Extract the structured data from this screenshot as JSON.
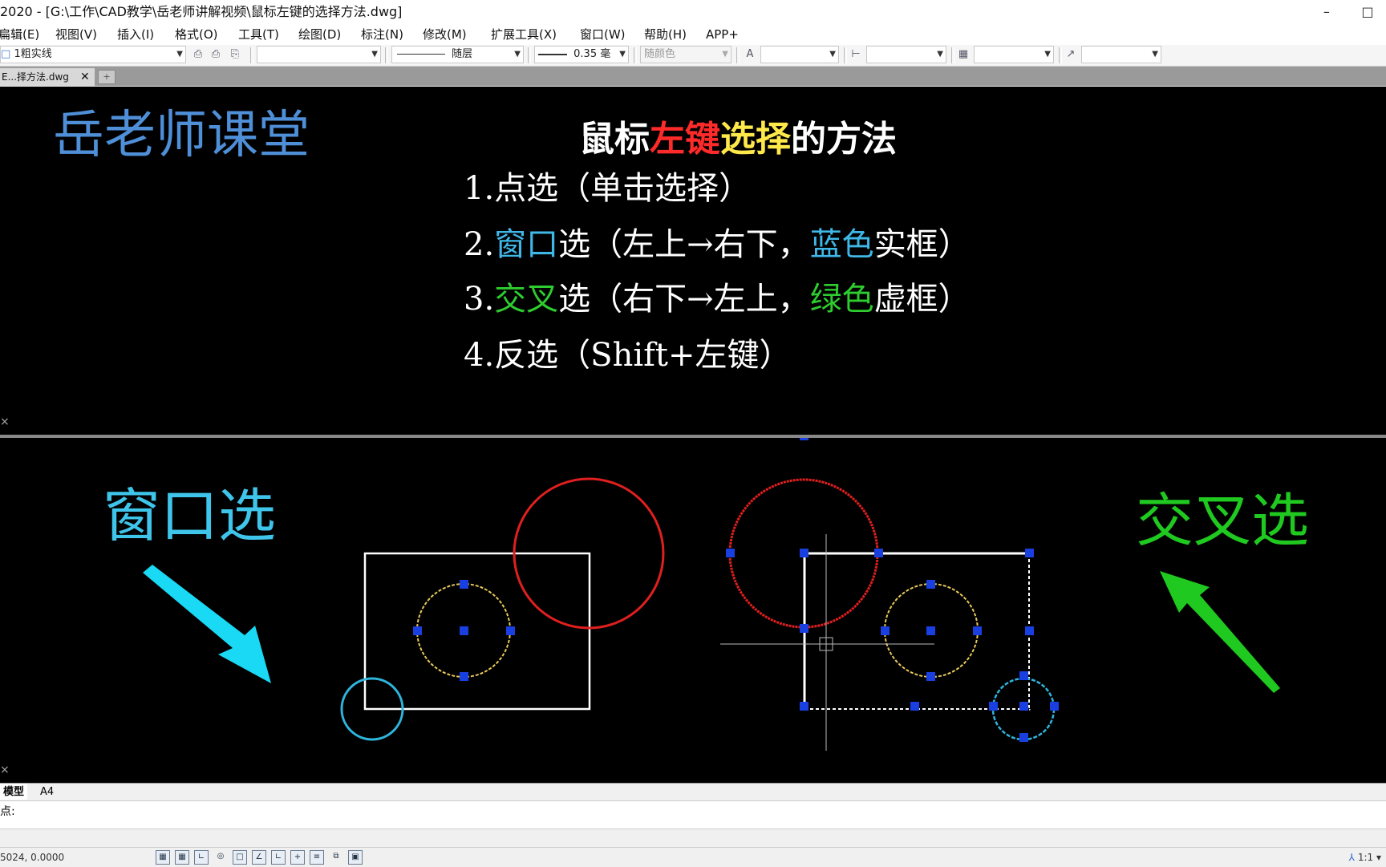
{
  "window": {
    "title": "2020 - [G:\\工作\\CAD教学\\岳老师讲解视频\\鼠标左键的选择方法.dwg]",
    "min_icon": "minimize-icon",
    "max_icon": "maximize-icon",
    "close_icon": "close-icon"
  },
  "menu": [
    "编辑(E)",
    "视图(V)",
    "插入(I)",
    "格式(O)",
    "工具(T)",
    "绘图(D)",
    "标注(N)",
    "修改(M)",
    "扩展工具(X)",
    "窗口(W)",
    "帮助(H)",
    "APP+"
  ],
  "menu_first_display": "扁辑(E)",
  "toolbar": {
    "layer_value": "1粗实线",
    "linetype_value": "随层",
    "lineweight_value": "0.35 毫",
    "color_value": "随颜色",
    "textstyle_value": "",
    "dimstyle_value": "",
    "tablestyle_value": "",
    "mleaderstyle_value": ""
  },
  "tabs": {
    "doc_tab_label": "E...择方法.dwg",
    "doc_tab_close": "✕",
    "new_tab_icon": "new-tab-icon"
  },
  "drawing_top": {
    "brand": "岳老师课堂",
    "heading_parts": [
      {
        "text": "鼠标",
        "color": "#ffffff"
      },
      {
        "text": "左键",
        "color": "#ff2a2a"
      },
      {
        "text": "选择",
        "color": "#ffe84a"
      },
      {
        "text": "的方法",
        "color": "#ffffff"
      }
    ],
    "lines": [
      [
        {
          "text": "1.点选（单击选择）",
          "color": "#ffffff"
        }
      ],
      [
        {
          "text": "2.",
          "color": "#ffffff"
        },
        {
          "text": "窗口",
          "color": "#3fb8e8"
        },
        {
          "text": "选（左上→右下，",
          "color": "#ffffff"
        },
        {
          "text": "蓝色",
          "color": "#3fb8e8"
        },
        {
          "text": "实框）",
          "color": "#ffffff"
        }
      ],
      [
        {
          "text": "3.",
          "color": "#ffffff"
        },
        {
          "text": "交叉",
          "color": "#2ecc2e"
        },
        {
          "text": "选（右下→左上，",
          "color": "#ffffff"
        },
        {
          "text": "绿色",
          "color": "#2ecc2e"
        },
        {
          "text": "虚框）",
          "color": "#ffffff"
        }
      ],
      [
        {
          "text": "4.反选（Shift+左键）",
          "color": "#ffffff"
        }
      ]
    ]
  },
  "drawing_bottom": {
    "left_label": "窗口选",
    "right_label": "交叉选",
    "left_color": "#3fc4ea",
    "right_color": "#1fc91f"
  },
  "layout_tabs": [
    "模型",
    "A4"
  ],
  "command": {
    "prompt": "点:"
  },
  "status": {
    "coords": "5024, 0.0000",
    "scale": "1:1",
    "icons": [
      "grid-icon",
      "snap-icon",
      "ortho-icon",
      "polar-icon",
      "osnap-icon",
      "otrack-icon",
      "ducs-icon",
      "dyn-icon",
      "lineweight-icon",
      "selection-cycle-icon",
      "model-space-icon"
    ]
  }
}
